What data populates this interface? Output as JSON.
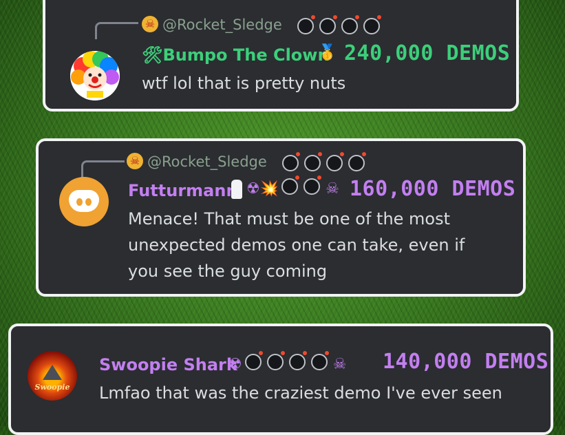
{
  "messages": [
    {
      "reply_to": "@Rocket_Sledge",
      "author": "🛠Bumpo The Clown",
      "badge_emoji": "🥇",
      "demos": "240,000 DEMOS",
      "text": "wtf lol that is pretty nuts",
      "name_color": "#3ccf7a",
      "demos_color": "#3ccf7a"
    },
    {
      "reply_to": "@Rocket_Sledge",
      "author": "Futturmann",
      "badge_emoji": "☢💥",
      "demos": "160,000 DEMOS",
      "text": "Menace! That must be one of the most unexpected demos one can take, even if you see the guy coming",
      "name_color": "#c37ff0",
      "demos_color": "#c37ff0"
    },
    {
      "author": "Swoopie Shark",
      "badge_emoji": "☢",
      "demos": "140,000 DEMOS",
      "text": "Lmfao that was the craziest demo I've ever seen",
      "avatar_text": "Swoopie",
      "name_color": "#c37ff0",
      "demos_color": "#c37ff0"
    }
  ],
  "icons": {
    "reply_avatar": "skull-icon",
    "bomb": "bomb-icon",
    "gasmask": "gas-mask-icon",
    "saltshaker": "salt-shaker-icon"
  }
}
